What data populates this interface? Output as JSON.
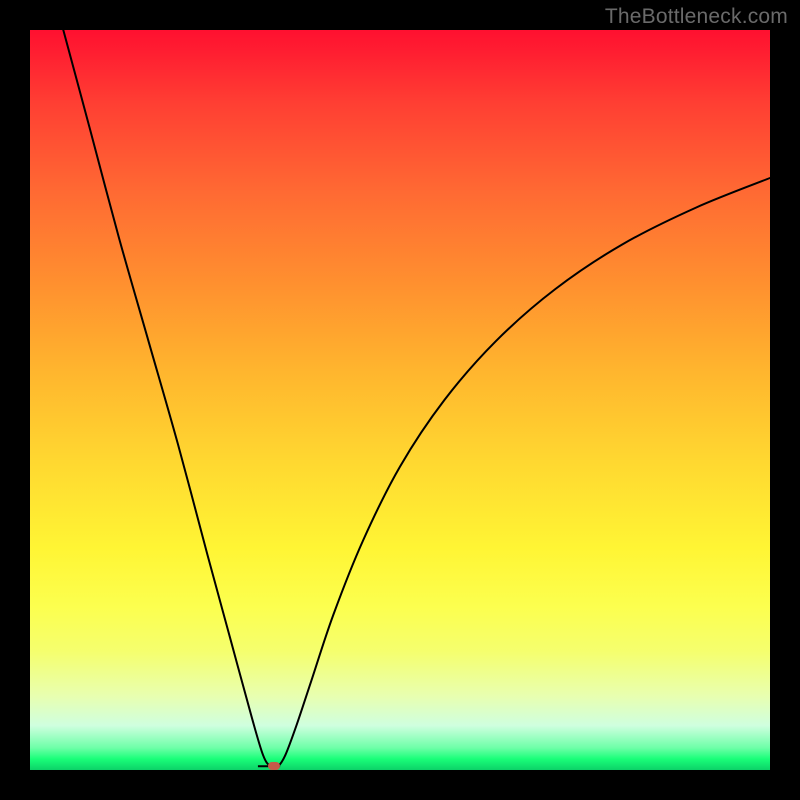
{
  "watermark": "TheBottleneck.com",
  "chart_data": {
    "type": "line",
    "title": "",
    "xlabel": "",
    "ylabel": "",
    "xlim": [
      0,
      100
    ],
    "ylim": [
      0,
      100
    ],
    "grid": false,
    "legend": false,
    "gradient_stops": [
      {
        "pos": 0,
        "color": "#ff1030"
      },
      {
        "pos": 10,
        "color": "#ff3f33"
      },
      {
        "pos": 22,
        "color": "#ff6a33"
      },
      {
        "pos": 34,
        "color": "#ff8f2f"
      },
      {
        "pos": 46,
        "color": "#ffb52e"
      },
      {
        "pos": 58,
        "color": "#ffd730"
      },
      {
        "pos": 70,
        "color": "#fff534"
      },
      {
        "pos": 78,
        "color": "#fcff4f"
      },
      {
        "pos": 84,
        "color": "#f5ff6e"
      },
      {
        "pos": 90,
        "color": "#e8ffb0"
      },
      {
        "pos": 94,
        "color": "#cfffdf"
      },
      {
        "pos": 97,
        "color": "#6effa8"
      },
      {
        "pos": 98.5,
        "color": "#1aff79"
      },
      {
        "pos": 100,
        "color": "#0cd268"
      }
    ],
    "series": [
      {
        "name": "bottleneck-curve",
        "x": [
          4.5,
          8,
          12,
          16,
          20,
          24,
          27,
          30,
          31.5,
          32.5,
          33.5,
          34.5,
          36,
          38,
          41,
          45,
          50,
          56,
          63,
          71,
          80,
          90,
          100
        ],
        "y": [
          100,
          87,
          72,
          58,
          44,
          29,
          18,
          7,
          2,
          0.5,
          0.5,
          2,
          6,
          12,
          21,
          31,
          41,
          50,
          58,
          65,
          71,
          76,
          80
        ]
      }
    ],
    "marker": {
      "x": 33,
      "y": 0.5,
      "color": "#c55a49"
    },
    "floor_line": {
      "x0": 30.8,
      "x1": 33.8,
      "y": 0.5
    }
  }
}
